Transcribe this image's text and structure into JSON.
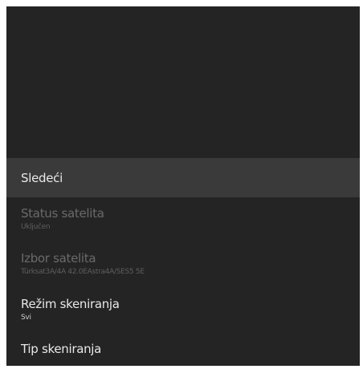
{
  "menu": {
    "items": [
      {
        "title": "Sledeći",
        "subtitle": "",
        "state": "selected"
      },
      {
        "title": "Status satelita",
        "subtitle": "Uključen",
        "state": "disabled"
      },
      {
        "title": "Izbor satelita",
        "subtitle": "Türksat3A/4A 42.0EAstra4A/SES5 5E",
        "state": "disabled"
      },
      {
        "title": "Režim skeniranja",
        "subtitle": "Svi",
        "state": "enabled"
      },
      {
        "title": "Tip skeniranja",
        "subtitle": "",
        "state": "enabled"
      }
    ]
  },
  "colors": {
    "panel_background": "#242424",
    "selected_background": "#3a3a3a",
    "text_enabled": "#e8e8e8",
    "text_disabled": "#6a6a6a"
  }
}
